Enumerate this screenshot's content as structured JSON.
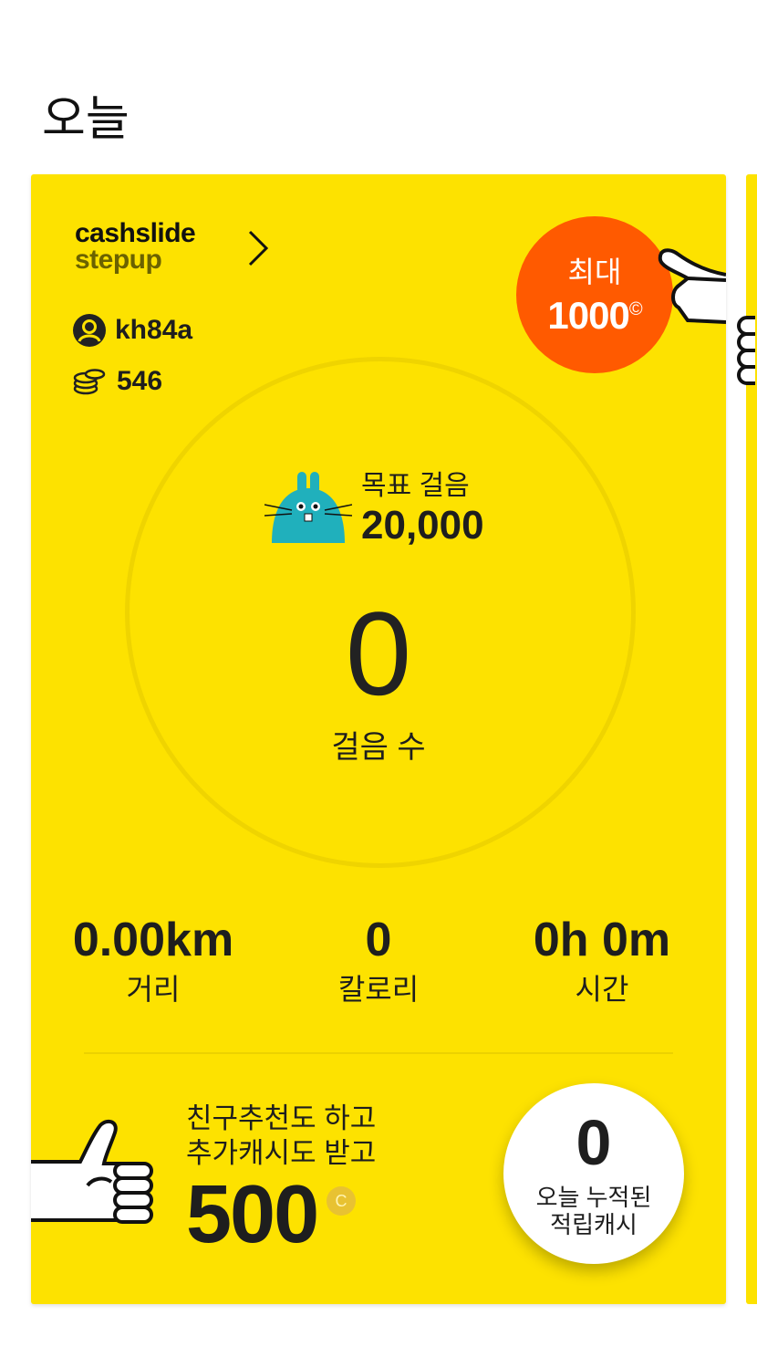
{
  "header": {
    "title": "오늘"
  },
  "card": {
    "brand_line1": "cashslide",
    "brand_line2": "stepup",
    "username": "kh84a",
    "coins": "546",
    "max_badge": {
      "label": "최대",
      "value": "1000",
      "coin_symbol": "©"
    },
    "goal": {
      "label": "목표 걸음",
      "value": "20,000"
    },
    "steps": {
      "value": "0",
      "label": "걸음 수"
    },
    "stats": [
      {
        "value": "0.00km",
        "label": "거리"
      },
      {
        "value": "0",
        "label": "칼로리"
      },
      {
        "value": "0h 0m",
        "label": "시간"
      }
    ],
    "promo": {
      "line1": "친구추천도 하고",
      "line2": "추가캐시도 받고",
      "amount": "500",
      "coin_symbol": "C"
    },
    "today_cash": {
      "value": "0",
      "label_line1": "오늘 누적된",
      "label_line2": "적립캐시"
    }
  },
  "colors": {
    "card_bg": "#fde200",
    "badge": "#ff5a00",
    "bunny": "#20b0bc"
  },
  "icons": [
    "chevron-right-icon",
    "user-icon",
    "coins-icon",
    "bunny-icon",
    "hand-icon",
    "thumbs-up-icon"
  ]
}
